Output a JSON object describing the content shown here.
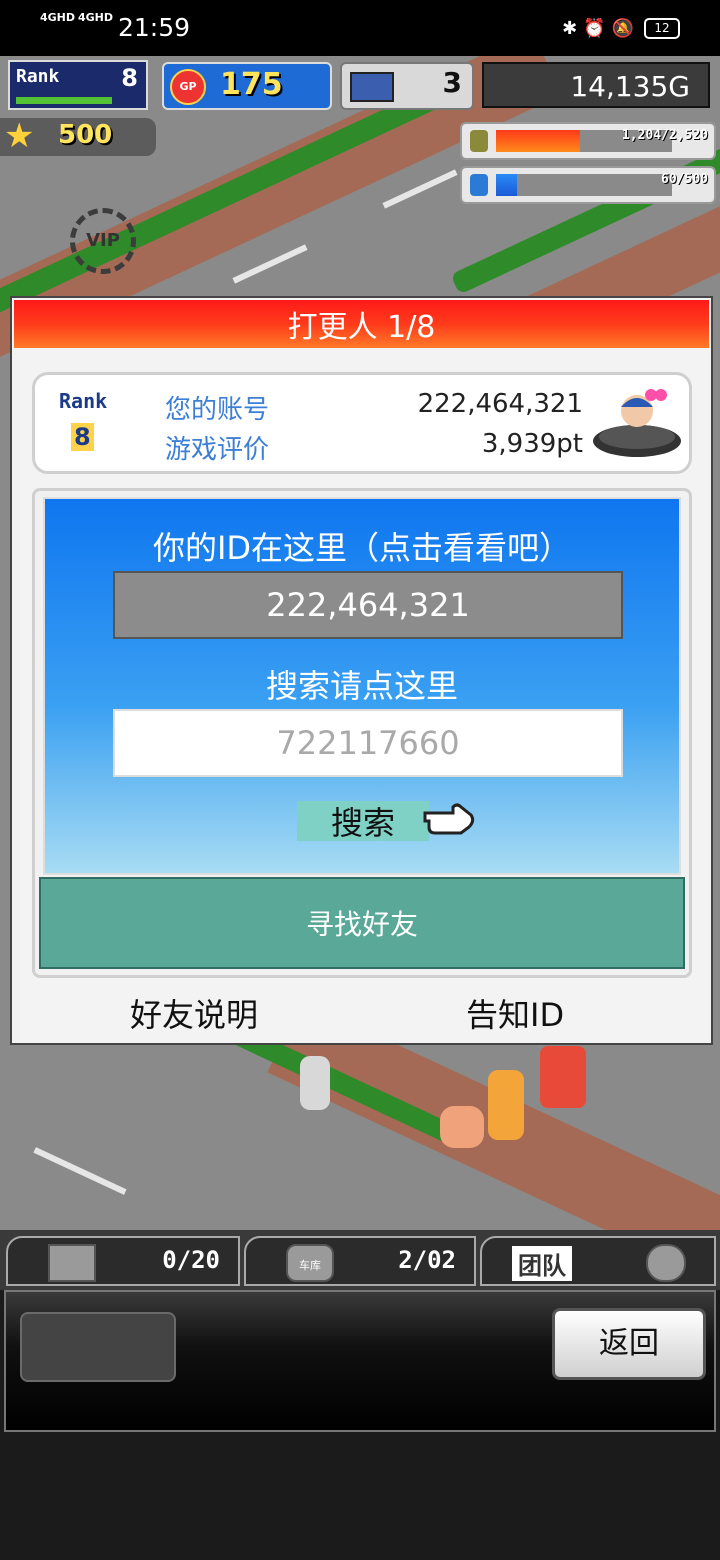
{
  "status_bar": {
    "signal1": "4GHD",
    "signal2": "4GHD",
    "time": "21:59",
    "battery": "12"
  },
  "hud": {
    "rank_label": "Rank",
    "rank_value": "8",
    "gp_label": "GP",
    "gp_value": "175",
    "pc_value": "3",
    "money": "14,135G",
    "star_value": "500",
    "resource1_text": "1,204/2,520",
    "resource1_fraction": 0.48,
    "resource2_text": "60/500",
    "resource2_fraction": 0.12,
    "vip_label": "VIP"
  },
  "dialog": {
    "title": "打更人 1/8",
    "card": {
      "rank_label": "Rank",
      "rank_value": "8",
      "account_label": "您的账号",
      "account_value": "222,464,321",
      "rating_label": "游戏评价",
      "rating_value": "3,939pt"
    },
    "id_heading": "你的ID在这里（点击看看吧）",
    "my_id": "222,464,321",
    "search_heading": "搜索请点这里",
    "search_value": "722117660",
    "search_button": "搜索",
    "find_friends": "寻找好友",
    "friend_help": "好友说明",
    "tell_id": "告知ID"
  },
  "bottom": {
    "tab1_count": "0/20",
    "tab2_label": "车库",
    "tab2_count": "2/02",
    "tab3_label": "团队",
    "back_button": "返回"
  },
  "colors": {
    "title_red": "#ff2a1a",
    "panel_blue": "#1f86f0",
    "find_button": "#5aa898",
    "account_label_blue": "#3d7fd6"
  }
}
